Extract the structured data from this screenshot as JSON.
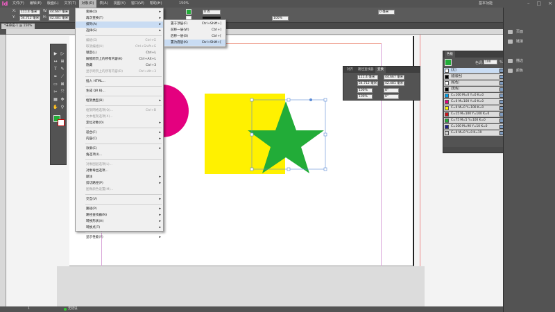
{
  "app": {
    "logo": "Id",
    "workspace": "基本功能",
    "zoom": "150%"
  },
  "menubar": [
    "文件(F)",
    "编辑(E)",
    "版面(L)",
    "文字(T)",
    "对象(O)",
    "表(A)",
    "视图(V)",
    "窗口(W)",
    "帮助(H)"
  ],
  "control": {
    "x": "111.4 毫米",
    "y": "54.712 毫米",
    "w": "44.667 毫米",
    "h": "42.481 毫米",
    "stroke": "0 点",
    "pct": "100%",
    "val": "0 毫米",
    "x_lbl": "X:",
    "y_lbl": "Y:",
    "w_lbl": "W:",
    "h_lbl": "H:"
  },
  "doc_tab": "*未命名-1 @ 150%",
  "object_menu": [
    {
      "label": "变换(O)",
      "sc": "",
      "arrow": true,
      "dis": false
    },
    {
      "label": "再次变换(T)",
      "sc": "",
      "arrow": true,
      "dis": false
    },
    {
      "label": "排列(A)",
      "sc": "",
      "arrow": true,
      "dis": false,
      "hl": true
    },
    {
      "label": "选择(S)",
      "sc": "",
      "arrow": true,
      "dis": false
    },
    {
      "sep": true
    },
    {
      "label": "编组(G)",
      "sc": "Ctrl+G",
      "dis": true
    },
    {
      "label": "取消编组(U)",
      "sc": "Ctrl+Shift+G",
      "dis": true
    },
    {
      "label": "锁定(L)",
      "sc": "Ctrl+L",
      "dis": false
    },
    {
      "label": "解锁跨页上的所有内容(K)",
      "sc": "Ctrl+Alt+L",
      "dis": false
    },
    {
      "label": "隐藏",
      "sc": "Ctrl+3",
      "dis": false
    },
    {
      "label": "显示跨页上的所有内容(D)",
      "sc": "Ctrl+Alt+3",
      "dis": true
    },
    {
      "sep": true
    },
    {
      "label": "插入 HTML...",
      "sc": "",
      "dis": false
    },
    {
      "sep": true
    },
    {
      "label": "生成 QR 码...",
      "sc": "",
      "dis": false
    },
    {
      "sep": true
    },
    {
      "label": "框架类型(B)",
      "sc": "",
      "arrow": true,
      "dis": false
    },
    {
      "sep": true
    },
    {
      "label": "框架网格选项(Q)...",
      "sc": "Ctrl+B",
      "dis": true
    },
    {
      "label": "文本框架选项(X)...",
      "sc": "",
      "dis": true
    },
    {
      "label": "定位对象(O)",
      "sc": "",
      "arrow": true,
      "dis": false
    },
    {
      "sep": true
    },
    {
      "label": "适合(F)",
      "sc": "",
      "arrow": true,
      "dis": false
    },
    {
      "label": "内容(C)",
      "sc": "",
      "arrow": true,
      "dis": false
    },
    {
      "sep": true
    },
    {
      "label": "效果(E)",
      "sc": "",
      "arrow": true,
      "dis": false
    },
    {
      "label": "角选项(I)...",
      "sc": "",
      "dis": false
    },
    {
      "sep": true
    },
    {
      "label": "对象图层选项(L)...",
      "sc": "",
      "dis": true
    },
    {
      "label": "对象导出选项...",
      "sc": "",
      "dis": false
    },
    {
      "label": "题注",
      "sc": "",
      "arrow": true,
      "dis": false
    },
    {
      "label": "剪切路径(P)",
      "sc": "",
      "arrow": true,
      "dis": false
    },
    {
      "label": "图像颜色设置(M)...",
      "sc": "",
      "dis": true
    },
    {
      "sep": true
    },
    {
      "label": "交互(V)",
      "sc": "",
      "arrow": true,
      "dis": false
    },
    {
      "sep": true
    },
    {
      "label": "路径(P)",
      "sc": "",
      "arrow": true,
      "dis": false
    },
    {
      "label": "路径查找器(N)",
      "sc": "",
      "arrow": true,
      "dis": false
    },
    {
      "label": "转换形状(H)",
      "sc": "",
      "arrow": true,
      "dis": false
    },
    {
      "label": "转换点(T)",
      "sc": "",
      "arrow": true,
      "dis": false
    },
    {
      "sep": true
    },
    {
      "label": "显示性能(Y)",
      "sc": "",
      "arrow": true,
      "dis": false
    }
  ],
  "arrange_menu": [
    {
      "label": "置于顶层(F)",
      "sc": "Ctrl+Shift+]"
    },
    {
      "label": "前移一层(W)",
      "sc": "Ctrl+]"
    },
    {
      "label": "后移一层(B)",
      "sc": "Ctrl+["
    },
    {
      "label": "置为底层(K)",
      "sc": "Ctrl+Shift+[",
      "hl": true
    }
  ],
  "transform_panel": {
    "tabs": [
      "对齐",
      "路径查找器",
      "变换"
    ],
    "x": "111.4 毫米",
    "y": "54.712 毫米",
    "w": "44.667 毫米",
    "h": "42.481 毫米",
    "sx": "100%",
    "sy": "100%",
    "rot": "0°",
    "shear": "0°"
  },
  "swatches": {
    "tab": "色板",
    "tint_label": "色调:",
    "tint": "100",
    "pct": "%",
    "rows": [
      {
        "name": "[无]",
        "color": "#ffffff"
      },
      {
        "name": "[套版色]",
        "color": "#000000"
      },
      {
        "name": "[纸色]",
        "color": "#ffffff"
      },
      {
        "name": "[黑色]",
        "color": "#000000"
      },
      {
        "name": "C=100 M=0 Y=0 K=0",
        "color": "#00a0e9"
      },
      {
        "name": "C=0 M=100 Y=0 K=0",
        "color": "#e4007f"
      },
      {
        "name": "C=0 M=0 Y=100 K=0",
        "color": "#fff100"
      },
      {
        "name": "C=15 M=100 Y=100 K=0",
        "color": "#c8161d"
      },
      {
        "name": "C=75 M=5 Y=100 K=0",
        "color": "#22ac38"
      },
      {
        "name": "C=100 M=90 Y=10 K=0",
        "color": "#1d2088"
      },
      {
        "name": "C=0 M=0 Y=0 K=19",
        "color": "#d3d3d3"
      }
    ]
  },
  "dock": [
    "页面",
    "链接",
    "描边",
    "颜色"
  ],
  "status": {
    "page": "1",
    "state": "无错误"
  },
  "colors": {
    "magenta": "#e4007f",
    "yellow": "#fff100",
    "green": "#22ac38"
  }
}
